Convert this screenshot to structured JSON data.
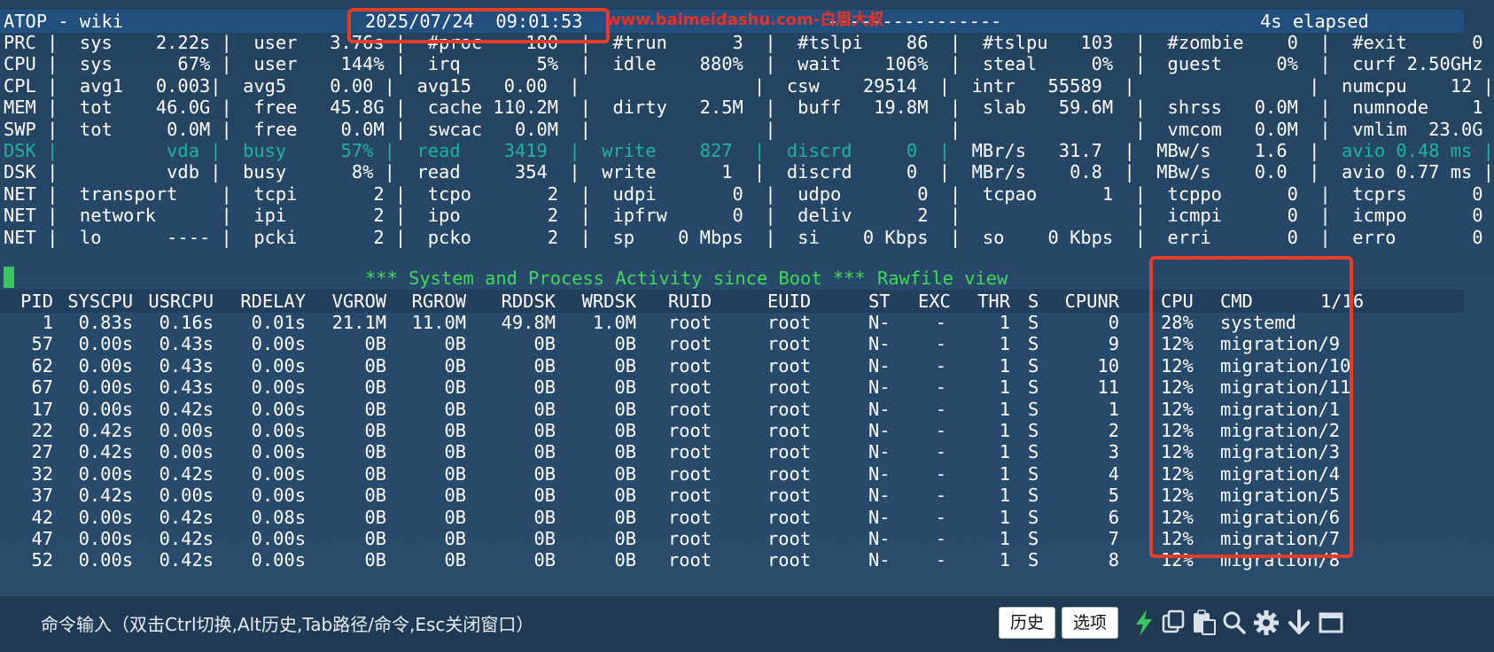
{
  "header": {
    "title": "ATOP - wiki",
    "datetime": "2025/07/24  09:01:53",
    "dashes": "----------------",
    "elapsed": "4s elapsed"
  },
  "watermark": "www.baimeidashu.com-白眉大叔",
  "system_lines": [
    {
      "text": "PRC |  sys    2.22s |  user   3.76s |  #proc    180  |  #trun      3  |  #tslpi    86  |  #tslpu   103  |  #zombie    0  |  #exit      0 |",
      "highlight": false
    },
    {
      "text": "CPU |  sys      67% |  user    144% |  irq       5%  |  idle    880%  |  wait    106%  |  steal     0%  |  guest     0%  |  curf 2.50GHz |",
      "highlight": false
    },
    {
      "text": "CPL |  avg1   0.003|  avg5    0.00 |  avg15   0.00  |                |  csw    29514  |  intr   55589  |                |  numcpu    12 |",
      "highlight": false
    },
    {
      "text": "MEM |  tot    46.0G |  free   45.8G |  cache 110.2M  |  dirty   2.5M  |  buff   19.8M  |  slab   59.6M  |  shrss   0.0M  |  numnode    1 |",
      "highlight": false
    },
    {
      "text": "SWP |  tot     0.0M |  free    0.0M |  swcac   0.0M  |                |                |                |  vmcom   0.0M  |  vmlim  23.0G |",
      "highlight": false
    },
    {
      "text": "DSK |          vda |  busy     57% |  read    3419  |  write    827  |  discrd     0  |",
      "rest": "  MBr/s   31.7  |  MBw/s    1.6  |",
      "tail": "  avio 0.48 ms |",
      "highlight": true
    },
    {
      "text": "DSK |          vdb |  busy      8% |  read     354  |  write      1  |  discrd     0  |  MBr/s    0.8  |  MBw/s    0.0  |  avio 0.77 ms |",
      "highlight": false
    },
    {
      "text": "NET |  transport    |  tcpi       2 |  tcpo       2  |  udpi       0  |  udpo       0  |  tcpao      1  |  tcppo      0  |  tcprs      0 |",
      "highlight": false
    },
    {
      "text": "NET |  network      |  ipi        2 |  ipo        2  |  ipfrw      0  |  deliv      2  |                |  icmpi      0  |  icmpo      0 |",
      "highlight": false
    },
    {
      "text": "NET |  lo      ---- |  pcki       2 |  pcko       2  |  sp    0 Mbps  |  si    0 Kbps  |  so    0 Kbps  |  erri       0  |  erro       0 |",
      "highlight": false
    }
  ],
  "banner": {
    "activity": "*** System and Process Activity since Boot ***",
    "view": "Rawfile view"
  },
  "process_table": {
    "columns": [
      "PID",
      "SYSCPU",
      "USRCPU",
      "RDELAY",
      "VGROW",
      "RGROW",
      "RDDSK",
      "WRDSK",
      "RUID",
      "EUID",
      "ST",
      "EXC",
      "THR",
      "S",
      "CPUNR",
      "CPU",
      "CMD"
    ],
    "page": "1/16",
    "rows": [
      [
        "1",
        "0.83s",
        "0.16s",
        "0.01s",
        "21.1M",
        "11.0M",
        "49.8M",
        "1.0M",
        "root",
        "root",
        "N-",
        "-",
        "1",
        "S",
        "0",
        "28%",
        "systemd"
      ],
      [
        "57",
        "0.00s",
        "0.43s",
        "0.00s",
        "0B",
        "0B",
        "0B",
        "0B",
        "root",
        "root",
        "N-",
        "-",
        "1",
        "S",
        "9",
        "12%",
        "migration/9"
      ],
      [
        "62",
        "0.00s",
        "0.43s",
        "0.00s",
        "0B",
        "0B",
        "0B",
        "0B",
        "root",
        "root",
        "N-",
        "-",
        "1",
        "S",
        "10",
        "12%",
        "migration/10"
      ],
      [
        "67",
        "0.00s",
        "0.43s",
        "0.00s",
        "0B",
        "0B",
        "0B",
        "0B",
        "root",
        "root",
        "N-",
        "-",
        "1",
        "S",
        "11",
        "12%",
        "migration/11"
      ],
      [
        "17",
        "0.00s",
        "0.42s",
        "0.00s",
        "0B",
        "0B",
        "0B",
        "0B",
        "root",
        "root",
        "N-",
        "-",
        "1",
        "S",
        "1",
        "12%",
        "migration/1"
      ],
      [
        "22",
        "0.42s",
        "0.00s",
        "0.00s",
        "0B",
        "0B",
        "0B",
        "0B",
        "root",
        "root",
        "N-",
        "-",
        "1",
        "S",
        "2",
        "12%",
        "migration/2"
      ],
      [
        "27",
        "0.42s",
        "0.00s",
        "0.00s",
        "0B",
        "0B",
        "0B",
        "0B",
        "root",
        "root",
        "N-",
        "-",
        "1",
        "S",
        "3",
        "12%",
        "migration/3"
      ],
      [
        "32",
        "0.00s",
        "0.42s",
        "0.00s",
        "0B",
        "0B",
        "0B",
        "0B",
        "root",
        "root",
        "N-",
        "-",
        "1",
        "S",
        "4",
        "12%",
        "migration/4"
      ],
      [
        "37",
        "0.42s",
        "0.00s",
        "0.00s",
        "0B",
        "0B",
        "0B",
        "0B",
        "root",
        "root",
        "N-",
        "-",
        "1",
        "S",
        "5",
        "12%",
        "migration/5"
      ],
      [
        "42",
        "0.00s",
        "0.42s",
        "0.08s",
        "0B",
        "0B",
        "0B",
        "0B",
        "root",
        "root",
        "N-",
        "-",
        "1",
        "S",
        "6",
        "12%",
        "migration/6"
      ],
      [
        "47",
        "0.00s",
        "0.42s",
        "0.00s",
        "0B",
        "0B",
        "0B",
        "0B",
        "root",
        "root",
        "N-",
        "-",
        "1",
        "S",
        "7",
        "12%",
        "migration/7"
      ],
      [
        "52",
        "0.00s",
        "0.42s",
        "0.00s",
        "0B",
        "0B",
        "0B",
        "0B",
        "root",
        "root",
        "N-",
        "-",
        "1",
        "S",
        "8",
        "12%",
        "migration/8"
      ]
    ]
  },
  "bottom_bar": {
    "command_hint": "命令输入（双击Ctrl切换,Alt历史,Tab路径/命令,Esc关闭窗口）",
    "history_label": "历史",
    "options_label": "选项",
    "icons": [
      "lightning-icon",
      "copy-icon",
      "paste-icon",
      "search-icon",
      "gear-icon",
      "download-icon",
      "maximize-icon"
    ]
  },
  "colors": {
    "highlight": "#21b39d",
    "banner_green": "#44d85a",
    "annotation_red": "#e53d2a",
    "header_bg": "#234f7e"
  }
}
